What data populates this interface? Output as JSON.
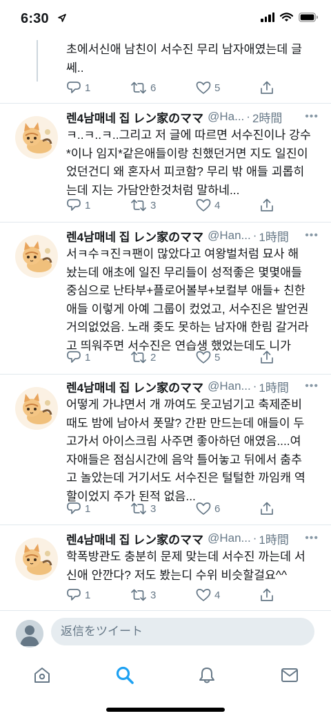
{
  "status_bar": {
    "time": "6:30"
  },
  "tweets": [
    {
      "text_lines": [
        "초에서신애 남친이 서수진 무리 남자애였는데 글",
        "쎄.."
      ],
      "replies": "1",
      "retweets": "6",
      "likes": "5"
    },
    {
      "name": "렌4남매네 집 レン家のママ",
      "handle": "@Ha...",
      "time": "2時間",
      "text_lines": [
        "ㅋ..ㅋ..ㅋ..그리고 저 글에 따르면 서수진이나 강수",
        "*이나 임지*같은애들이랑 친했던거면 지도 일진이",
        "었던건디 왜 혼자서 피코함? 무리 밖 애들 괴롭히",
        "는데 지는 가담안한것처럼 말하네..."
      ],
      "replies": "1",
      "retweets": "3",
      "likes": "4"
    },
    {
      "name": "렌4남매네 집 レン家のママ",
      "handle": "@Han...",
      "time": "1時間",
      "text_lines": [
        "서ㅋ수ㅋ진ㅋ팬이 많았다고 여왕벌처럼 묘사 해",
        "놨는데 애초에 일진 무리들이 성적좋은 몇몇애들",
        "중심으로 난타부+플로어볼부+보컬부 애들+ 친한",
        "애들 이렇게 아예 그룹이 컸었고, 서수진은 발언권",
        "거의없었음. 노래 좆도 못하는 남자애 한림 갈거라",
        "고 띄워주면 서수진은 연습생 했었는데도 니가"
      ],
      "replies": "1",
      "retweets": "2",
      "likes": "5"
    },
    {
      "name": "렌4남매네 집 レン家のママ",
      "handle": "@Han...",
      "time": "1時間",
      "text_lines": [
        "어떻게 가냐면서 개 까여도 웃고넘기고 축제준비",
        "때도 밤에 남아서 폿말? 간판 만드는데 애들이 두",
        "고가서 아이스크림 사주면 좋아하던 애였음....여",
        "자애들은 점심시간에 음악 틀어놓고 뒤에서 춤추",
        "고 놀았는데 거기서도 서수진은 털털한 까임캐 역",
        "할이었지 주가 된적 없음..."
      ],
      "replies": "1",
      "retweets": "3",
      "likes": "6"
    },
    {
      "name": "렌4남매네 집 レン家のママ",
      "handle": "@Han...",
      "time": "1時間",
      "text_lines": [
        "학폭방관도 충분히 문제 맞는데 서수진 까는데 서",
        "신애 안깐다? 저도 봤는디 수위 비슷할걸요^^"
      ],
      "replies": "1",
      "retweets": "3",
      "likes": "4"
    }
  ],
  "reply_bar": {
    "placeholder": "返信をツイート"
  },
  "tabs": [
    "home",
    "search",
    "notifications",
    "messages"
  ],
  "colors": {
    "accent": "#1da1f2",
    "secondary_text": "#657786",
    "divider": "#e1e8ed"
  }
}
